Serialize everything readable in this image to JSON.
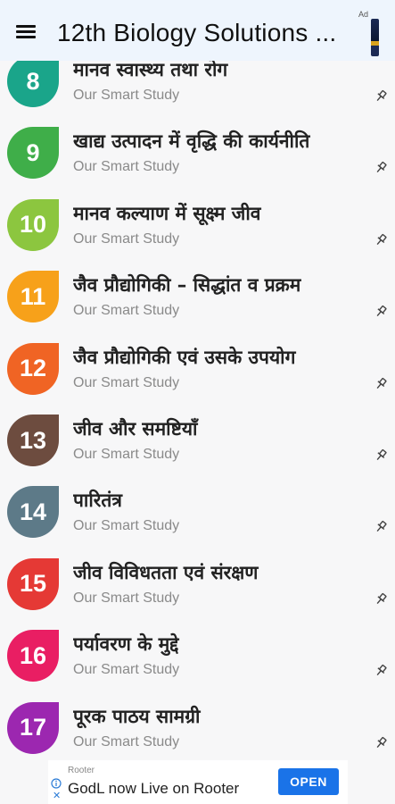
{
  "appbar": {
    "menu_icon": "hamburger-menu-icon",
    "title": "12th Biology Solutions ...",
    "ad_label": "Ad"
  },
  "chapters": [
    {
      "number": "8",
      "title": "मानव स्वास्थ्य तथा रोग",
      "subtitle": "Our Smart Study",
      "color": "#1aa58a"
    },
    {
      "number": "9",
      "title": "खाद्य उत्पादन में वृद्धि की कार्यनीति",
      "subtitle": "Our Smart Study",
      "color": "#3fae49"
    },
    {
      "number": "10",
      "title": "मानव कल्याण में सूक्ष्म जीव",
      "subtitle": "Our Smart Study",
      "color": "#8cc63f"
    },
    {
      "number": "11",
      "title": "जैव प्रौद्योगिकी – सिद्धांत व प्रक्रम",
      "subtitle": "Our Smart Study",
      "color": "#f7a11a"
    },
    {
      "number": "12",
      "title": "जैव प्रौद्योगिकी एवं उसके उपयोग",
      "subtitle": "Our Smart Study",
      "color": "#f06424"
    },
    {
      "number": "13",
      "title": "जीव और समष्टियाँ",
      "subtitle": "Our Smart Study",
      "color": "#6d4c3f"
    },
    {
      "number": "14",
      "title": "पारितंत्र",
      "subtitle": "Our Smart Study",
      "color": "#5d7a88"
    },
    {
      "number": "15",
      "title": "जीव विविधतता एवं संरक्षण",
      "subtitle": "Our Smart Study",
      "color": "#e53935"
    },
    {
      "number": "16",
      "title": "पर्यावरण के मुद्दे",
      "subtitle": "Our Smart Study",
      "color": "#e91e63"
    },
    {
      "number": "17",
      "title": "पूरक पाठय सामग्री",
      "subtitle": "Our Smart Study",
      "color": "#9c27b0"
    }
  ],
  "pin_icon": "pin-icon",
  "ad_banner": {
    "source": "Rooter",
    "headline": "GodL now Live on Rooter",
    "cta": "OPEN",
    "info_icon": "info-icon",
    "close_icon": "close-icon"
  }
}
